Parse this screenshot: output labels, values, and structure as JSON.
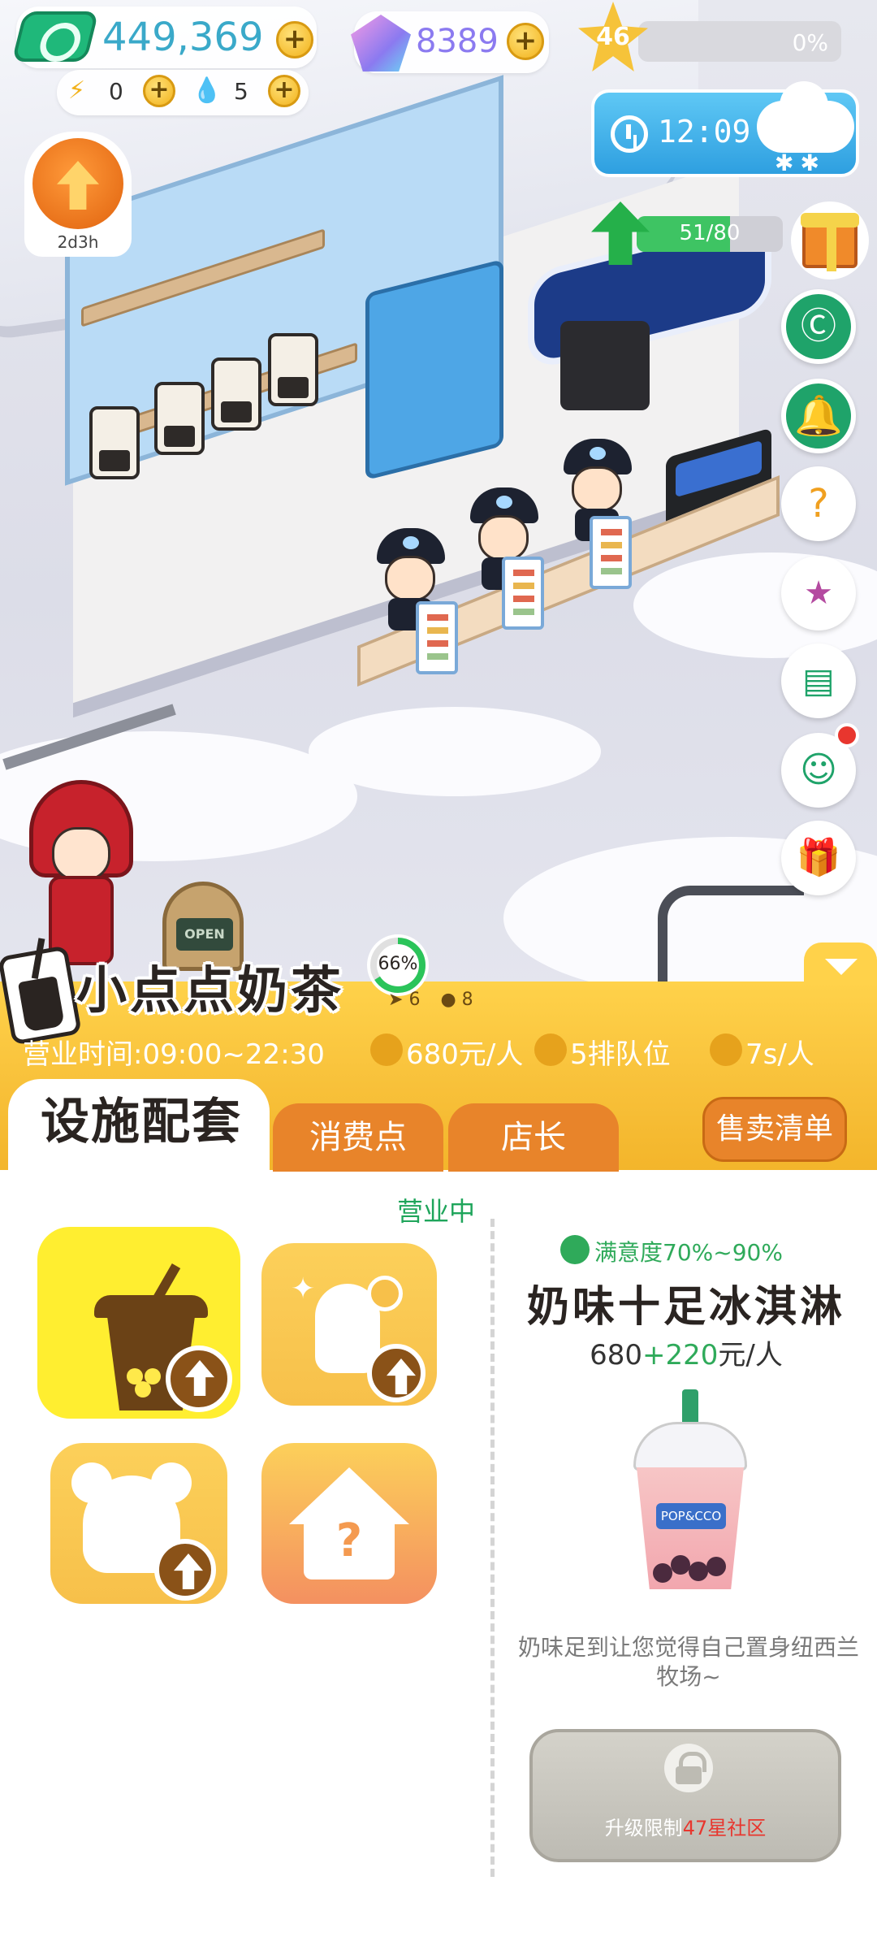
{
  "hud": {
    "coins": "449,369",
    "gems": "8389",
    "energy": "0",
    "water": "5",
    "star_level": "46",
    "xp_percent_text": "0%",
    "xp_fraction": 0.0,
    "weather_time": "12:09",
    "upgrade_timer": "2d3h",
    "shop_xp_text": "51/80",
    "shop_xp_fraction": 0.6375
  },
  "shop": {
    "name": "小点点奶茶",
    "progress_text": "66%",
    "progress_fraction": 0.66,
    "mini_arrow": "6",
    "mini_drop": "8",
    "hours": "营业时间:09:00~22:30",
    "price_per_person": "680元/人",
    "queue": "5排队位",
    "serve_time": "7s/人"
  },
  "tabs": {
    "facilities": "设施配套",
    "consumption": "消费点",
    "manager": "店长",
    "sell_list": "售卖清单"
  },
  "panel": {
    "status": "营业中",
    "satisfaction": "满意度70%~90%",
    "product_name": "奶味十足冰淇淋",
    "price_base": "680",
    "price_bonus": "+220",
    "price_unit": "元/人",
    "product_label": "POP&CCO",
    "description": "奶味足到让您觉得自己置身纽西兰牧场~",
    "lock_prefix": "升级限制",
    "lock_highlight": "47星社区"
  },
  "colors": {
    "brand_yellow": "#ffd24a",
    "tab_orange": "#e8842a",
    "accent_green": "#2faa5a",
    "coin_green": "#1fb87a"
  },
  "icons": [
    "coin-icon",
    "gem-icon",
    "star-icon",
    "energy-icon",
    "water-drop-icon",
    "clock-icon",
    "cloud-icon",
    "upgrade-arrow-icon",
    "gift-icon",
    "chat-icon",
    "bell-icon",
    "mystery-box-icon",
    "star-book-icon",
    "notes-icon",
    "ghost-icon",
    "present-icon",
    "lock-icon"
  ]
}
